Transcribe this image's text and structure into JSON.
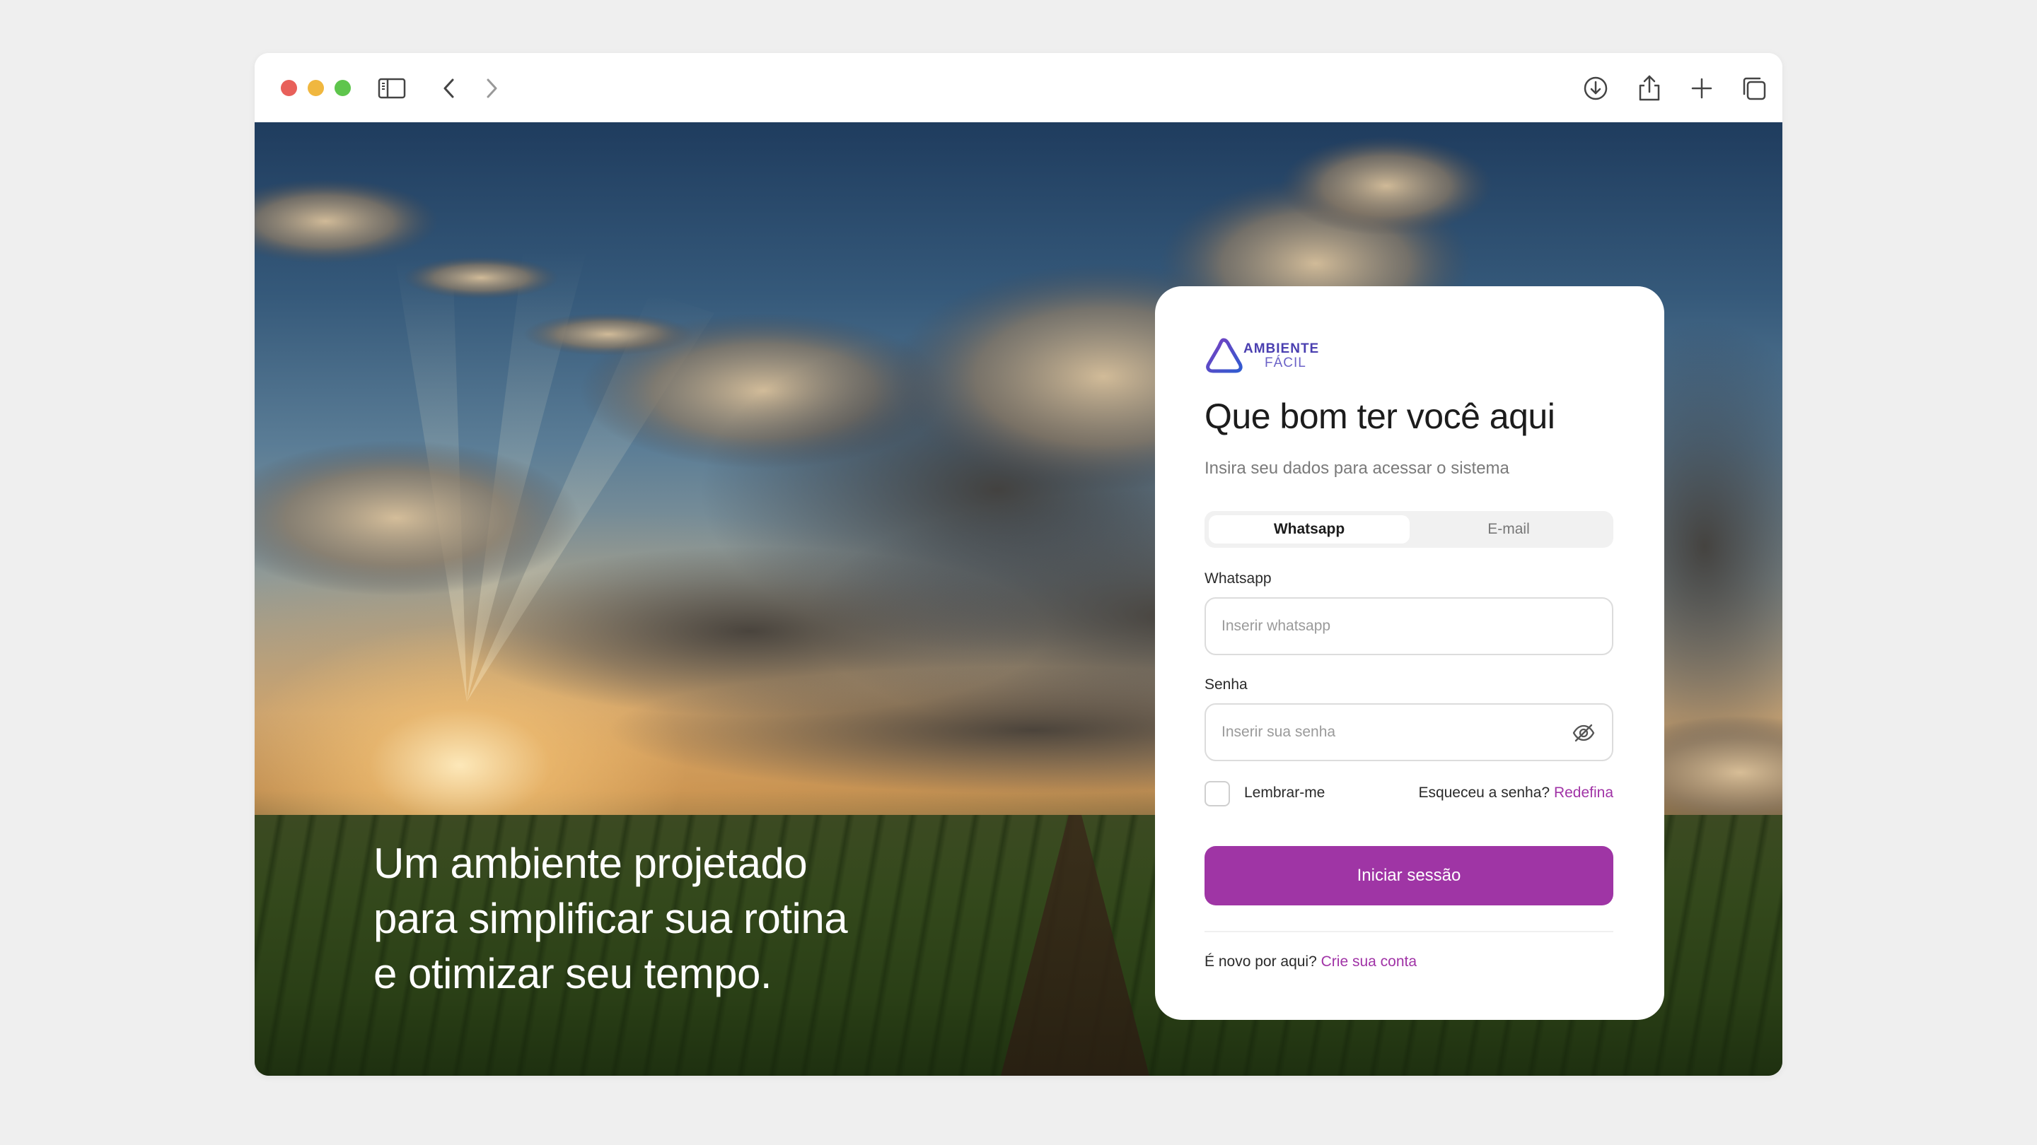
{
  "browser": {
    "controls": [
      "close",
      "minimize",
      "maximize"
    ],
    "left_icons": [
      "sidebar-icon",
      "back-icon",
      "forward-icon"
    ],
    "right_icons": [
      "download-icon",
      "share-icon",
      "new-tab-icon",
      "tabs-overview-icon"
    ]
  },
  "hero": {
    "headline_lines": [
      "Um ambiente projetado",
      "para simplificar sua rotina",
      "e otimizar seu tempo."
    ]
  },
  "login": {
    "logo": {
      "line1": "AMBIENTE",
      "line2": "FÁCIL"
    },
    "title": "Que bom ter você aqui",
    "subtitle": "Insira seu dados para acessar o sistema",
    "tabs": [
      {
        "label": "Whatsapp",
        "active": true
      },
      {
        "label": "E-mail",
        "active": false
      }
    ],
    "whatsapp": {
      "label": "Whatsapp",
      "placeholder": "Inserir whatsapp",
      "value": ""
    },
    "password": {
      "label": "Senha",
      "placeholder": "Inserir sua senha",
      "value": ""
    },
    "remember_label": "Lembrar-me",
    "forgot_text": "Esqueceu a senha?",
    "forgot_link": "Redefina",
    "submit_label": "Iniciar sessão",
    "signup_text": "É novo por aqui?",
    "signup_link": "Crie sua conta"
  },
  "colors": {
    "accent": "#9f35a5",
    "link": "#a033a6",
    "logo": "#4a3fb0"
  }
}
